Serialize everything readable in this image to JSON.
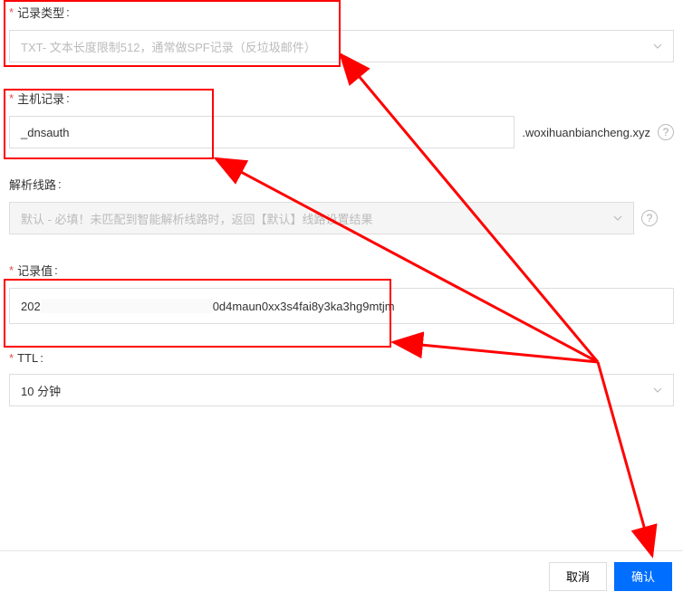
{
  "record_type": {
    "label": "记录类型",
    "value": "TXT- 文本长度限制512，通常做SPF记录（反垃圾邮件）"
  },
  "host_record": {
    "label": "主机记录",
    "value": "_dnsauth",
    "suffix": ".woxihuanbiancheng.xyz"
  },
  "resolve_line": {
    "label": "解析线路",
    "value": "默认 - 必填！未匹配到智能解析线路时，返回【默认】线路设置结果"
  },
  "record_value": {
    "label": "记录值",
    "value_prefix": "202",
    "value_suffix": "0d4maun0xx3s4fai8y3ka3hg9mtjm"
  },
  "ttl": {
    "label": "TTL",
    "value": "10 分钟"
  },
  "footer": {
    "cancel": "取消",
    "confirm": "确认"
  },
  "colors": {
    "accent": "#006eff",
    "annotation": "#ff0000"
  }
}
